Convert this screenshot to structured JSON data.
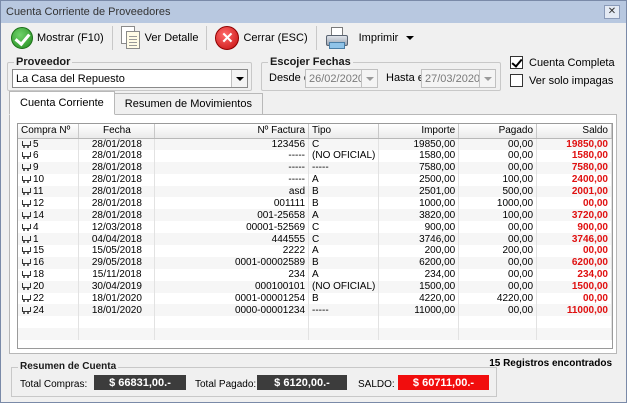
{
  "window": {
    "title": "Cuenta Corriente de Proveedores",
    "close_glyph": "✕"
  },
  "toolbar": {
    "mostrar_label": "Mostrar (F10)",
    "ver_detalle_label": "Ver Detalle",
    "cerrar_label": "Cerrar (ESC)",
    "imprimir_label": "Imprimir"
  },
  "proveedor": {
    "legend": "Proveedor",
    "value": "La Casa del Repuesto"
  },
  "fechas": {
    "legend": "Escojer Fechas",
    "desde_label": "Desde el:",
    "desde_value": "26/02/2020",
    "hasta_label": "Hasta el:",
    "hasta_value": "27/03/2020"
  },
  "options": {
    "cuenta_completa_label": "Cuenta Completa",
    "cuenta_completa_checked": true,
    "solo_impagas_label": "Ver solo impagas",
    "solo_impagas_checked": false
  },
  "tabs": [
    {
      "label": "Cuenta Corriente",
      "active": true
    },
    {
      "label": "Resumen de Movimientos",
      "active": false
    }
  ],
  "table": {
    "columns": [
      "Compra Nº",
      "Fecha",
      "Nº Factura",
      "Tipo",
      "Importe",
      "Pagado",
      "Saldo"
    ],
    "rows": [
      [
        "5",
        "28/01/2018",
        "123456",
        "C",
        "19850,00",
        "00,00",
        "19850,00"
      ],
      [
        "6",
        "28/01/2018",
        "-----",
        "(NO OFICIAL)",
        "1580,00",
        "00,00",
        "1580,00"
      ],
      [
        "9",
        "28/01/2018",
        "-----",
        "-----",
        "7580,00",
        "00,00",
        "7580,00"
      ],
      [
        "10",
        "28/01/2018",
        "-----",
        "A",
        "2500,00",
        "100,00",
        "2400,00"
      ],
      [
        "11",
        "28/01/2018",
        "asd",
        "B",
        "2501,00",
        "500,00",
        "2001,00"
      ],
      [
        "12",
        "28/01/2018",
        "001111",
        "B",
        "1000,00",
        "1000,00",
        "00,00"
      ],
      [
        "14",
        "28/01/2018",
        "001-25658",
        "A",
        "3820,00",
        "100,00",
        "3720,00"
      ],
      [
        "4",
        "12/03/2018",
        "00001-52569",
        "C",
        "900,00",
        "00,00",
        "900,00"
      ],
      [
        "1",
        "04/04/2018",
        "444555",
        "C",
        "3746,00",
        "00,00",
        "3746,00"
      ],
      [
        "15",
        "15/05/2018",
        "2222",
        "A",
        "200,00",
        "200,00",
        "00,00"
      ],
      [
        "16",
        "29/05/2018",
        "0001-00002589",
        "B",
        "6200,00",
        "00,00",
        "6200,00"
      ],
      [
        "18",
        "15/11/2018",
        "234",
        "A",
        "234,00",
        "00,00",
        "234,00"
      ],
      [
        "20",
        "30/04/2019",
        "000100101",
        "(NO OFICIAL)",
        "1500,00",
        "00,00",
        "1500,00"
      ],
      [
        "22",
        "18/01/2020",
        "0001-00001254",
        "B",
        "4220,00",
        "4220,00",
        "00,00"
      ],
      [
        "24",
        "18/01/2020",
        "0000-00001234",
        "-----",
        "11000,00",
        "00,00",
        "11000,00"
      ]
    ]
  },
  "records_found": "15 Registros encontrados",
  "summary": {
    "legend": "Resumen de Cuenta",
    "total_compras_label": "Total Compras:",
    "total_compras_value": "$ 66831,00.-",
    "total_pagado_label": "Total Pagado:",
    "total_pagado_value": "$ 6120,00.-",
    "saldo_label": "SALDO:",
    "saldo_value": "$ 60711,00.-"
  }
}
